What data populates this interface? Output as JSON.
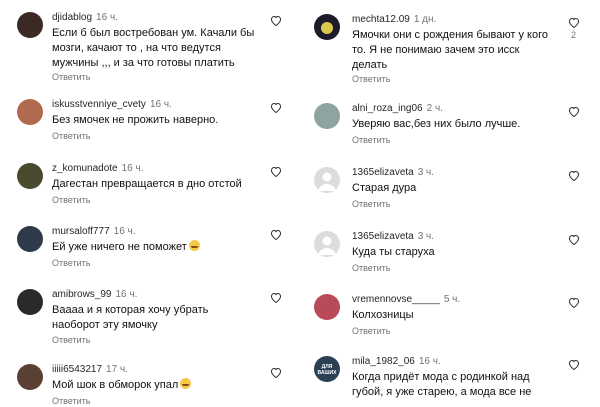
{
  "left": [
    {
      "user": "djidablog",
      "time": "16 ч.",
      "text": "Если б был востребован ум. Качали бы мозги, качают то , на что ведутся мужчины ,,, и за что готовы платить",
      "reply": "Ответить",
      "avatar": "#3b2a24"
    },
    {
      "user": "iskusstvenniye_cvety",
      "time": "16 ч.",
      "text": "Без ямочек не прожить наверно.",
      "reply": "Ответить",
      "avatar": "#b06a4e"
    },
    {
      "user": "z_komunadote",
      "time": "16 ч.",
      "text": "Дагестан превращается в дно отстой",
      "reply": "Ответить",
      "avatar": "#4a4a2e"
    },
    {
      "user": "mursaloff777",
      "time": "16 ч.",
      "text": "Ей уже ничего не поможет",
      "reply": "Ответить",
      "avatar": "#2f3b4a",
      "emoji": true
    },
    {
      "user": "amibrows_99",
      "time": "16 ч.",
      "text": "Ваааа и я которая хочу убрать наоборот эту ямочку",
      "reply": "Ответить",
      "avatar": "#2a2a2a"
    },
    {
      "user": "iiiii6543217",
      "time": "17 ч.",
      "text": "Мой шок в обморок упал",
      "reply": "Ответить",
      "avatar": "#5a4032",
      "emoji": true
    }
  ],
  "right": [
    {
      "user": "mechta12.09",
      "time": "1 дн.",
      "text": "Ямочки они с рождения бывают у кого то. Я не понимаю зачем это исск делать",
      "reply": "Ответить",
      "avatar": "#1d1b2a",
      "likes": "2"
    },
    {
      "user": "alni_roza_ing06",
      "time": "2 ч.",
      "text": "Уверяю вас,без них было лучше.",
      "reply": "Ответить",
      "avatar": "#8fa3a0"
    },
    {
      "user": "1365elizaveta",
      "time": "3 ч.",
      "text": "Старая дура",
      "reply": "Ответить",
      "avatar": "#dcdcdc",
      "placeholder": true
    },
    {
      "user": "1365elizaveta",
      "time": "3 ч.",
      "text": "Куда ты старуха",
      "reply": "Ответить",
      "avatar": "#dcdcdc",
      "placeholder": true
    },
    {
      "user": "vremennovse_____",
      "time": "5 ч.",
      "text": "Колхозницы",
      "reply": "Ответить",
      "avatar": "#b84a5a"
    },
    {
      "user": "mila_1982_06",
      "time": "16 ч.",
      "text": "Когда придёт мода с родинкой над губой, я уже старею, а мода все не",
      "reply": "",
      "avatar": "#2b3f55",
      "avatar_text": "ДЛЯ ВАШИХ"
    }
  ]
}
